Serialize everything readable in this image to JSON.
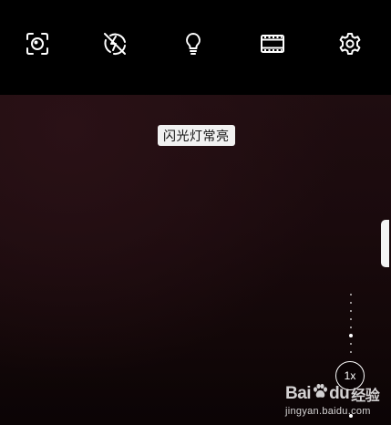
{
  "top_bar": {
    "buttons": [
      {
        "icon": "ai-scene-icon",
        "interactable": true
      },
      {
        "icon": "flash-off-icon",
        "interactable": true
      },
      {
        "icon": "bulb-icon",
        "interactable": true
      },
      {
        "icon": "aspect-ratio-icon",
        "interactable": true
      },
      {
        "icon": "settings-gear-icon",
        "interactable": true
      }
    ]
  },
  "viewfinder": {
    "hint_text": "闪光灯常亮"
  },
  "zoom": {
    "level_label": "1x"
  },
  "watermark": {
    "brand_left": "Bai",
    "brand_right": "du",
    "brand_cn": "经验",
    "url": "jingyan.baidu.com"
  },
  "colors": {
    "background": "#000000",
    "viewfinder_tint": "#1a0a0d",
    "icon": "#ffffff",
    "tip_bg": "#f1f1f1"
  }
}
